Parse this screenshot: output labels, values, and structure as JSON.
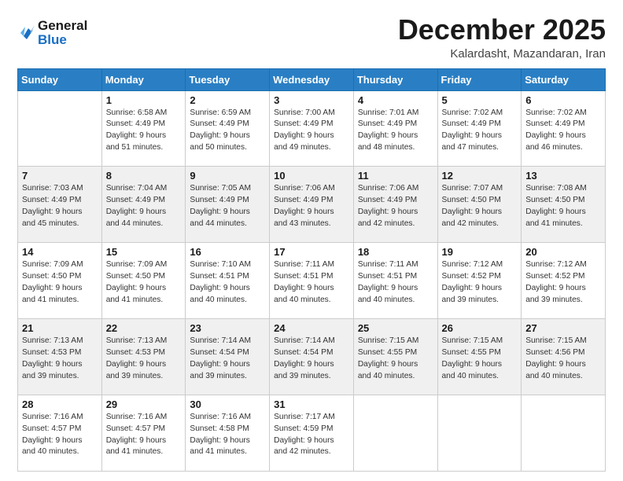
{
  "header": {
    "logo_line1": "General",
    "logo_line2": "Blue",
    "month": "December 2025",
    "location": "Kalardasht, Mazandaran, Iran"
  },
  "weekdays": [
    "Sunday",
    "Monday",
    "Tuesday",
    "Wednesday",
    "Thursday",
    "Friday",
    "Saturday"
  ],
  "weeks": [
    [
      {
        "day": "",
        "info": ""
      },
      {
        "day": "1",
        "info": "Sunrise: 6:58 AM\nSunset: 4:49 PM\nDaylight: 9 hours\nand 51 minutes."
      },
      {
        "day": "2",
        "info": "Sunrise: 6:59 AM\nSunset: 4:49 PM\nDaylight: 9 hours\nand 50 minutes."
      },
      {
        "day": "3",
        "info": "Sunrise: 7:00 AM\nSunset: 4:49 PM\nDaylight: 9 hours\nand 49 minutes."
      },
      {
        "day": "4",
        "info": "Sunrise: 7:01 AM\nSunset: 4:49 PM\nDaylight: 9 hours\nand 48 minutes."
      },
      {
        "day": "5",
        "info": "Sunrise: 7:02 AM\nSunset: 4:49 PM\nDaylight: 9 hours\nand 47 minutes."
      },
      {
        "day": "6",
        "info": "Sunrise: 7:02 AM\nSunset: 4:49 PM\nDaylight: 9 hours\nand 46 minutes."
      }
    ],
    [
      {
        "day": "7",
        "info": "Sunrise: 7:03 AM\nSunset: 4:49 PM\nDaylight: 9 hours\nand 45 minutes."
      },
      {
        "day": "8",
        "info": "Sunrise: 7:04 AM\nSunset: 4:49 PM\nDaylight: 9 hours\nand 44 minutes."
      },
      {
        "day": "9",
        "info": "Sunrise: 7:05 AM\nSunset: 4:49 PM\nDaylight: 9 hours\nand 44 minutes."
      },
      {
        "day": "10",
        "info": "Sunrise: 7:06 AM\nSunset: 4:49 PM\nDaylight: 9 hours\nand 43 minutes."
      },
      {
        "day": "11",
        "info": "Sunrise: 7:06 AM\nSunset: 4:49 PM\nDaylight: 9 hours\nand 42 minutes."
      },
      {
        "day": "12",
        "info": "Sunrise: 7:07 AM\nSunset: 4:50 PM\nDaylight: 9 hours\nand 42 minutes."
      },
      {
        "day": "13",
        "info": "Sunrise: 7:08 AM\nSunset: 4:50 PM\nDaylight: 9 hours\nand 41 minutes."
      }
    ],
    [
      {
        "day": "14",
        "info": "Sunrise: 7:09 AM\nSunset: 4:50 PM\nDaylight: 9 hours\nand 41 minutes."
      },
      {
        "day": "15",
        "info": "Sunrise: 7:09 AM\nSunset: 4:50 PM\nDaylight: 9 hours\nand 41 minutes."
      },
      {
        "day": "16",
        "info": "Sunrise: 7:10 AM\nSunset: 4:51 PM\nDaylight: 9 hours\nand 40 minutes."
      },
      {
        "day": "17",
        "info": "Sunrise: 7:11 AM\nSunset: 4:51 PM\nDaylight: 9 hours\nand 40 minutes."
      },
      {
        "day": "18",
        "info": "Sunrise: 7:11 AM\nSunset: 4:51 PM\nDaylight: 9 hours\nand 40 minutes."
      },
      {
        "day": "19",
        "info": "Sunrise: 7:12 AM\nSunset: 4:52 PM\nDaylight: 9 hours\nand 39 minutes."
      },
      {
        "day": "20",
        "info": "Sunrise: 7:12 AM\nSunset: 4:52 PM\nDaylight: 9 hours\nand 39 minutes."
      }
    ],
    [
      {
        "day": "21",
        "info": "Sunrise: 7:13 AM\nSunset: 4:53 PM\nDaylight: 9 hours\nand 39 minutes."
      },
      {
        "day": "22",
        "info": "Sunrise: 7:13 AM\nSunset: 4:53 PM\nDaylight: 9 hours\nand 39 minutes."
      },
      {
        "day": "23",
        "info": "Sunrise: 7:14 AM\nSunset: 4:54 PM\nDaylight: 9 hours\nand 39 minutes."
      },
      {
        "day": "24",
        "info": "Sunrise: 7:14 AM\nSunset: 4:54 PM\nDaylight: 9 hours\nand 39 minutes."
      },
      {
        "day": "25",
        "info": "Sunrise: 7:15 AM\nSunset: 4:55 PM\nDaylight: 9 hours\nand 40 minutes."
      },
      {
        "day": "26",
        "info": "Sunrise: 7:15 AM\nSunset: 4:55 PM\nDaylight: 9 hours\nand 40 minutes."
      },
      {
        "day": "27",
        "info": "Sunrise: 7:15 AM\nSunset: 4:56 PM\nDaylight: 9 hours\nand 40 minutes."
      }
    ],
    [
      {
        "day": "28",
        "info": "Sunrise: 7:16 AM\nSunset: 4:57 PM\nDaylight: 9 hours\nand 40 minutes."
      },
      {
        "day": "29",
        "info": "Sunrise: 7:16 AM\nSunset: 4:57 PM\nDaylight: 9 hours\nand 41 minutes."
      },
      {
        "day": "30",
        "info": "Sunrise: 7:16 AM\nSunset: 4:58 PM\nDaylight: 9 hours\nand 41 minutes."
      },
      {
        "day": "31",
        "info": "Sunrise: 7:17 AM\nSunset: 4:59 PM\nDaylight: 9 hours\nand 42 minutes."
      },
      {
        "day": "",
        "info": ""
      },
      {
        "day": "",
        "info": ""
      },
      {
        "day": "",
        "info": ""
      }
    ]
  ]
}
